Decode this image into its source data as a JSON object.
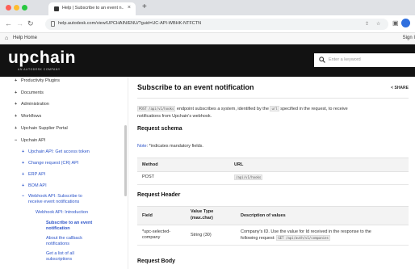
{
  "browser": {
    "tab_title": "Help | Subscribe to an event n...",
    "url": "help.autodesk.com/view/UPCHAIN/ENU/?guid=UC-API-WBHK-NTFCTN",
    "new_tab": "+",
    "tab_close": "×"
  },
  "helpbar": {
    "home_label": "Help Home",
    "signin_label": "Sign I"
  },
  "banner": {
    "logo": "upchain",
    "logo_sub": "AN AUTODESK COMPANY",
    "search_placeholder": "Enter a keyword"
  },
  "sidebar": {
    "items": [
      {
        "sign": "+",
        "label": "Productivity Plugins"
      },
      {
        "sign": "+",
        "label": "Documents"
      },
      {
        "sign": "+",
        "label": "Administration"
      },
      {
        "sign": "+",
        "label": "Workflows"
      },
      {
        "sign": "+",
        "label": "Upchain Supplier Portal"
      },
      {
        "sign": "−",
        "label": "Upchain API"
      },
      {
        "sign": "+",
        "label": "Upchain API: Get access token"
      },
      {
        "sign": "+",
        "label": "Change request (CR) API"
      },
      {
        "sign": "+",
        "label": "ERP API"
      },
      {
        "sign": "+",
        "label": "BOM API"
      },
      {
        "sign": "−",
        "label": "Webhook API: Subscribe to",
        "label2": "receive event notifications"
      },
      {
        "sign": "",
        "label": "Webhook API: Introduction"
      },
      {
        "sign": "",
        "label": "Subscribe to an event",
        "label2": "notification"
      },
      {
        "sign": "",
        "label": "About the callback",
        "label2": "notifications"
      },
      {
        "sign": "",
        "label": "Get a list of all",
        "label2": "subscriptions"
      }
    ]
  },
  "article": {
    "title": "Subscribe to an event notification",
    "share": "SHARE",
    "intro_code1": "POST /api/v1/hooks",
    "intro_text1": "endpoint subscribes a system, identified by the",
    "intro_code2": "url",
    "intro_text2": "specified in the request, to receive",
    "intro_text3": "notifications from Upchain's webhook.",
    "schema_heading": "Request schema",
    "note_label": "Note",
    "note_text": ": *indicates mandatory fields.",
    "schema_table": {
      "headers": [
        "Method",
        "URL"
      ],
      "rows": [
        [
          "POST",
          "/api/v1/hooks"
        ]
      ]
    },
    "header_heading": "Request Header",
    "header_table": {
      "headers": [
        "Field",
        "Value Type",
        "(max.char)",
        "Description of values"
      ],
      "row": {
        "field1": "*upc-selected-",
        "field2": "company",
        "type": "String (30)",
        "desc1": "Company's ID. Use the value for Id received in the response to the",
        "desc2": "following request:",
        "desc_code": "GET /api/auth/v1/companies"
      }
    },
    "body_heading": "Request Body"
  }
}
